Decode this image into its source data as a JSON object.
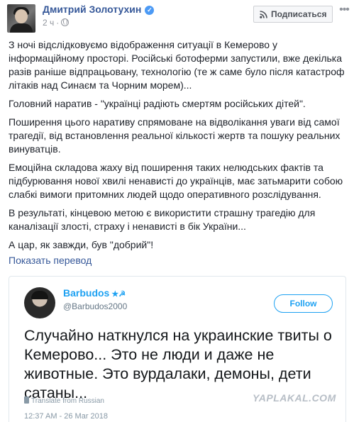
{
  "post": {
    "author": "Дмитрий Золотухин",
    "time": "2 ч",
    "meta_separator": "·",
    "subscribe_label": "Подписаться",
    "paragraphs": [
      "З ночі відслідковуємо відображення ситуації в Кемерово у інформаційному просторі. Російські ботоферми запустили, вже декілька разів раніше відпрацьовану, технологію (те ж саме було після катастроф літаків над Синаєм та Чорним морем)...",
      "Головний наратив - \"українці радіють смертям російських дітей\".",
      "Поширення цього наративу спрямоване на відволікання уваги від самої трагедії, від встановлення реальної кількості жертв та пошуку реальних винуватців.",
      "Емоційна складова жаху від поширення таких нелюдських фактів та підбурювання нової хвилі ненависті до українців, має затьмарити собою слабкі вимоги притомних людей щодо оперативного розслідування.",
      "В результаті, кінцевою метою є використити страшну трагедію для каналізації злості, страху і ненависті в бік України...",
      "А цар, як завжди, був \"добрий\"!"
    ],
    "translate_link": "Показать перевод"
  },
  "tweet": {
    "name": "Barbudos",
    "name_marks": "★☭",
    "handle": "@Barbudos2000",
    "follow_label": "Follow",
    "text": "Случайно наткнулся на украинские твиты о Кемерово... Это не люди и даже не животные. Это вурдалаки, демоны, дети сатаны...",
    "translate_note": "Translate from Russian",
    "timestamp": "12:37 AM - 26 Mar 2018"
  },
  "watermark": "YAPLAKAL.COM",
  "colors": {
    "facebook_link": "#365899",
    "twitter_blue": "#1da1f2",
    "verified_badge": "#4c9af5",
    "muted": "#90949c"
  }
}
